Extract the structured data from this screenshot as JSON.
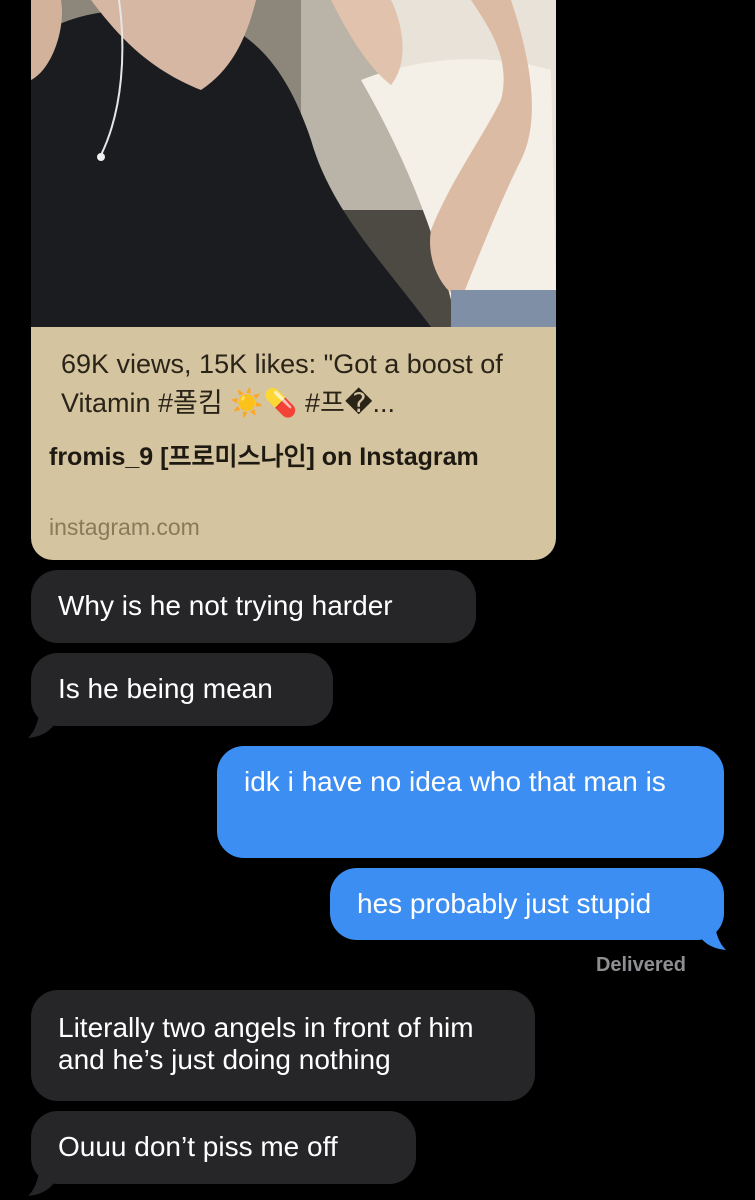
{
  "link_preview": {
    "description": "69K views, 15K likes: \"Got a boost of Vitamin #폴킴 ☀️💊 #프�...",
    "title": "fromis_9 [프로미스나인] on Instagram",
    "domain": "instagram.com"
  },
  "messages": [
    {
      "from": "them",
      "text": "Why is he not trying harder"
    },
    {
      "from": "them",
      "text": "Is he being mean"
    },
    {
      "from": "me",
      "text": "idk i have no idea who that man is"
    },
    {
      "from": "me",
      "text": "hes probably just stupid"
    },
    {
      "from": "them",
      "text": "Literally two angels in front of him and he’s just doing nothing"
    },
    {
      "from": "them",
      "text": "Ouuu don’t piss me off"
    }
  ],
  "status": {
    "delivered": "Delivered"
  },
  "colors": {
    "incoming_bubble": "#262628",
    "outgoing_bubble": "#3d8ef2",
    "card_background": "#d4c4a0",
    "background": "#000000"
  }
}
